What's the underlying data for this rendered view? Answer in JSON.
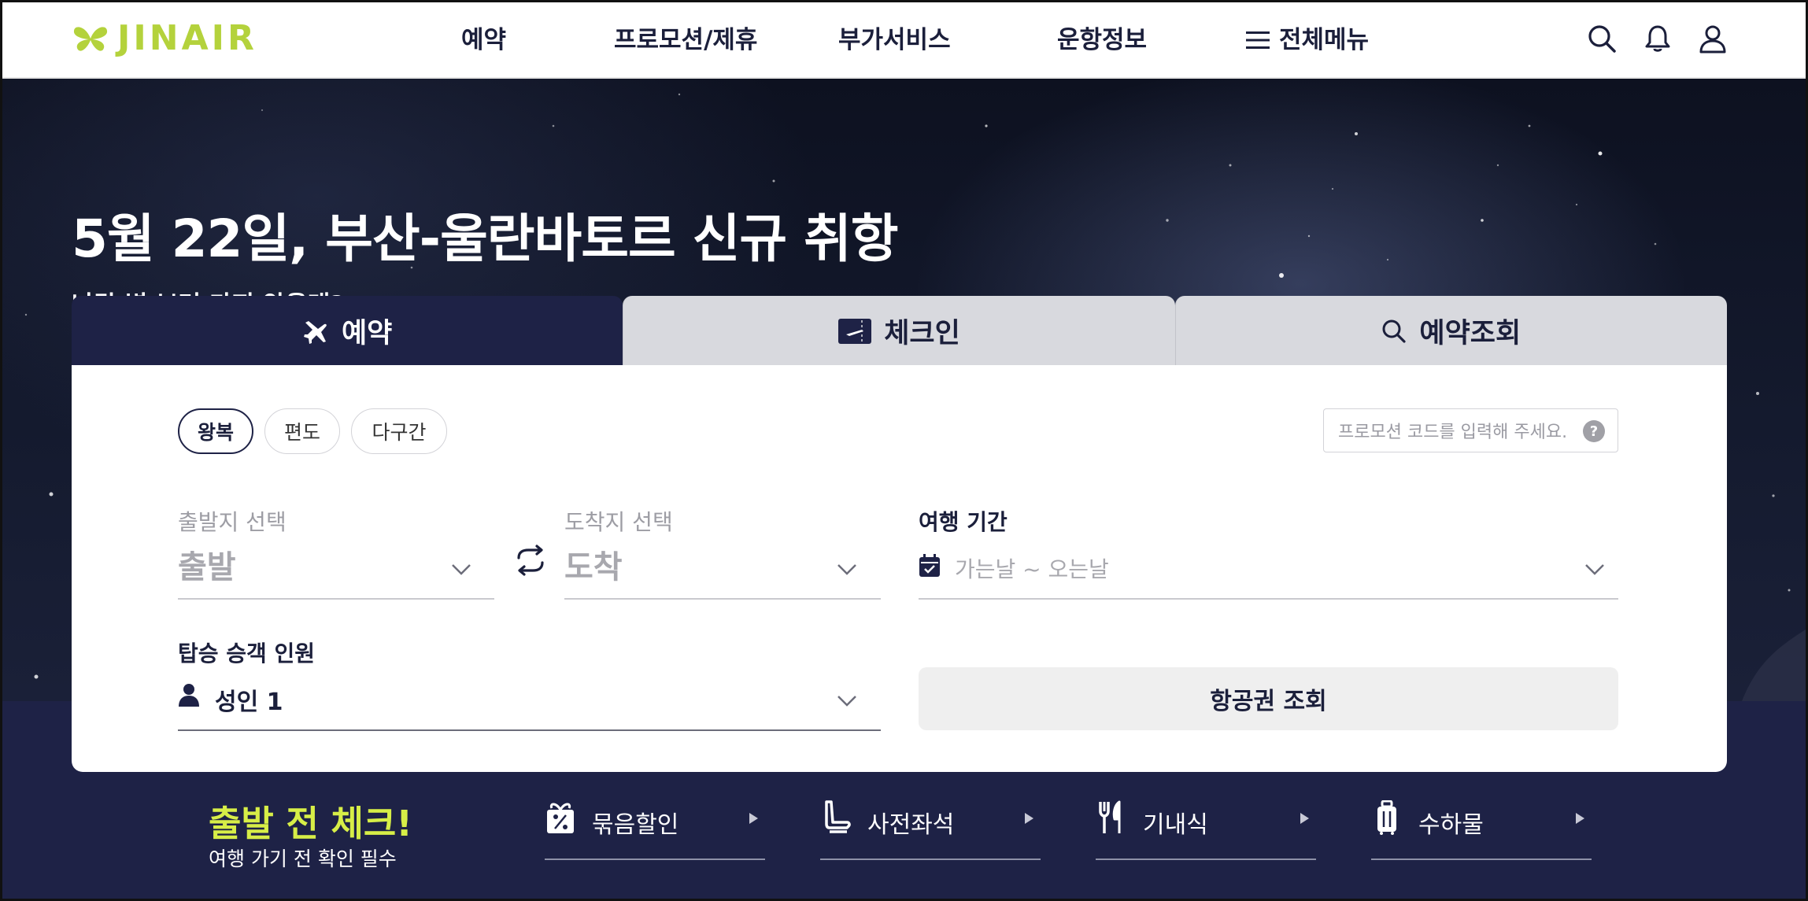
{
  "header": {
    "logo_text": "JINAIR",
    "nav": [
      {
        "label": "예약"
      },
      {
        "label": "프로모션/제휴"
      },
      {
        "label": "부가서비스"
      },
      {
        "label": "운항정보"
      },
      {
        "label": "전체메뉴",
        "icon": "hamburger-icon"
      }
    ],
    "icons": [
      "search-icon",
      "bell-icon",
      "user-icon"
    ],
    "brand_color": "#b4d23c"
  },
  "hero": {
    "title": "5월 22일, 부산-울란바토르 신규 취항",
    "subtitle": "나랑 별 보러 가지 않을래?"
  },
  "booking": {
    "tabs": [
      {
        "label": "예약",
        "icon": "airplane-icon",
        "active": true
      },
      {
        "label": "체크인",
        "icon": "boarding-pass-icon",
        "active": false
      },
      {
        "label": "예약조회",
        "icon": "search-icon",
        "active": false
      }
    ],
    "trip_types": [
      {
        "label": "왕복",
        "selected": true
      },
      {
        "label": "편도",
        "selected": false
      },
      {
        "label": "다구간",
        "selected": false
      }
    ],
    "promo_placeholder": "프로모션 코드를 입력해 주세요.",
    "promo_help": "?",
    "departure": {
      "label": "출발지 선택",
      "value": "출발"
    },
    "arrival": {
      "label": "도착지 선택",
      "value": "도착"
    },
    "period": {
      "label": "여행 기간",
      "value": "가는날 ~ 오는날"
    },
    "passengers": {
      "label": "탑승 승객 인원",
      "value": "성인 1"
    },
    "search_button": "항공권 조회",
    "accent_color": "#1e2246"
  },
  "pre_check": {
    "title": "출발 전 체크!",
    "subtitle": "여행 가기 전 확인 필수",
    "title_color": "#d7ee47",
    "items": [
      {
        "label": "묶음할인",
        "icon": "discount-gift-icon"
      },
      {
        "label": "사전좌석",
        "icon": "seat-icon"
      },
      {
        "label": "기내식",
        "icon": "fork-knife-icon"
      },
      {
        "label": "수하물",
        "icon": "luggage-icon"
      }
    ]
  }
}
